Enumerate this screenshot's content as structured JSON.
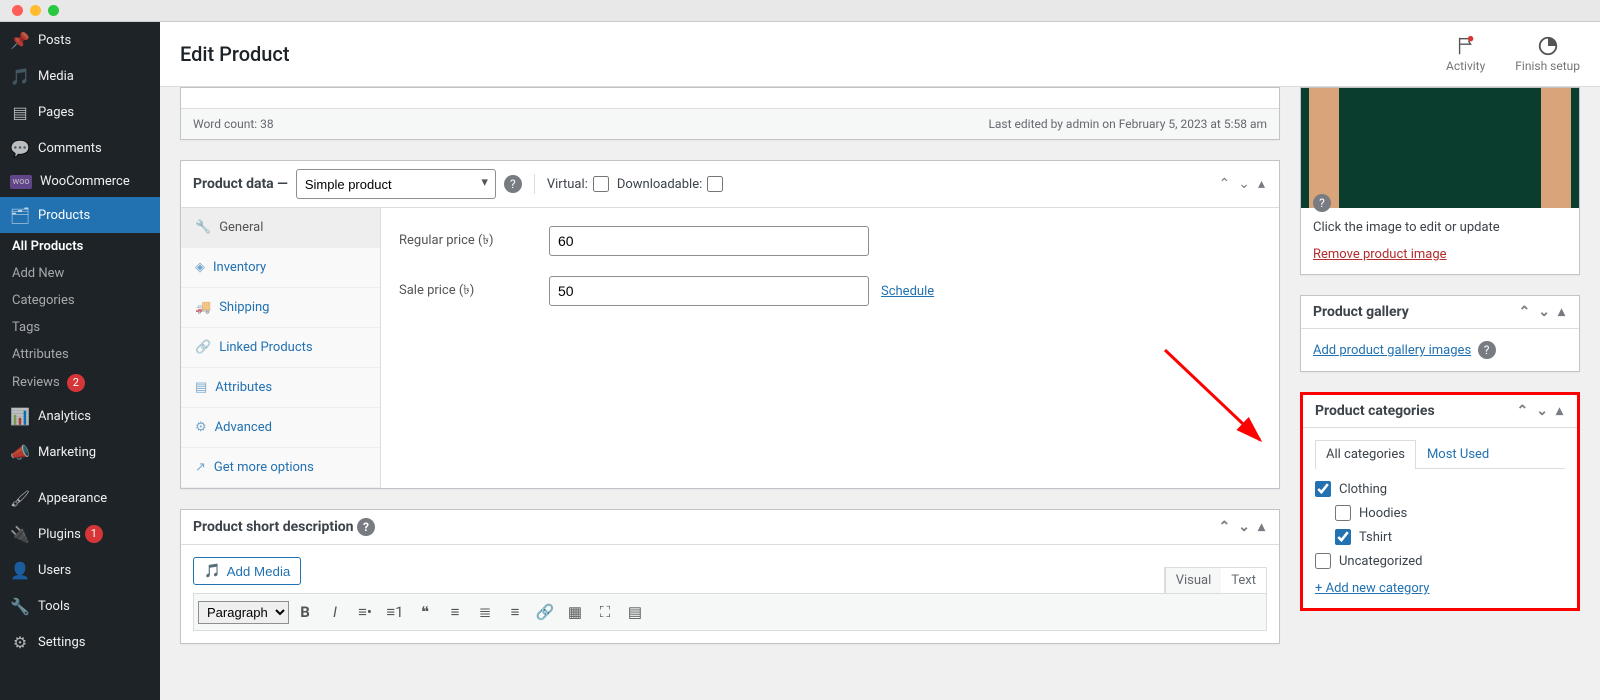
{
  "header": {
    "title": "Edit Product",
    "activity": "Activity",
    "finish": "Finish setup"
  },
  "sidebar": {
    "items": [
      {
        "label": "Posts",
        "icon": "pin"
      },
      {
        "label": "Media",
        "icon": "media"
      },
      {
        "label": "Pages",
        "icon": "page"
      },
      {
        "label": "Comments",
        "icon": "comment"
      },
      {
        "label": "WooCommerce",
        "icon": "woo"
      },
      {
        "label": "Products",
        "icon": "products",
        "active": true
      },
      {
        "label": "Analytics",
        "icon": "chart"
      },
      {
        "label": "Marketing",
        "icon": "megaphone"
      },
      {
        "label": "Appearance",
        "icon": "brush"
      },
      {
        "label": "Plugins",
        "icon": "plug",
        "badge": "1"
      },
      {
        "label": "Users",
        "icon": "user"
      },
      {
        "label": "Tools",
        "icon": "wrench"
      },
      {
        "label": "Settings",
        "icon": "gear"
      }
    ],
    "submenu": [
      {
        "label": "All Products",
        "current": true
      },
      {
        "label": "Add New"
      },
      {
        "label": "Categories"
      },
      {
        "label": "Tags"
      },
      {
        "label": "Attributes"
      },
      {
        "label": "Reviews",
        "badge": "2"
      }
    ]
  },
  "editor_footer": {
    "word_count": "Word count: 38",
    "last_edit": "Last edited by admin on February 5, 2023 at 5:58 am"
  },
  "product_data": {
    "title": "Product data",
    "type_selected": "Simple product",
    "virtual": "Virtual:",
    "downloadable": "Downloadable:",
    "tabs": [
      "General",
      "Inventory",
      "Shipping",
      "Linked Products",
      "Attributes",
      "Advanced",
      "Get more options"
    ],
    "general": {
      "regular_label": "Regular price (৳)",
      "regular_value": "60",
      "sale_label": "Sale price (৳)",
      "sale_value": "50",
      "schedule": "Schedule"
    }
  },
  "short_desc": {
    "title": "Product short description",
    "add_media": "Add Media",
    "tabs": {
      "visual": "Visual",
      "text": "Text"
    },
    "format_select": "Paragraph"
  },
  "product_image": {
    "note": "Click the image to edit or update",
    "remove": "Remove product image"
  },
  "gallery": {
    "title": "Product gallery",
    "add": "Add product gallery images"
  },
  "categories": {
    "title": "Product categories",
    "tabs": {
      "all": "All categories",
      "most": "Most Used"
    },
    "items": [
      {
        "label": "Clothing",
        "checked": true,
        "indent": false
      },
      {
        "label": "Hoodies",
        "checked": false,
        "indent": true
      },
      {
        "label": "Tshirt",
        "checked": true,
        "indent": true
      },
      {
        "label": "Uncategorized",
        "checked": false,
        "indent": false
      }
    ],
    "add_new": "+ Add new category"
  }
}
